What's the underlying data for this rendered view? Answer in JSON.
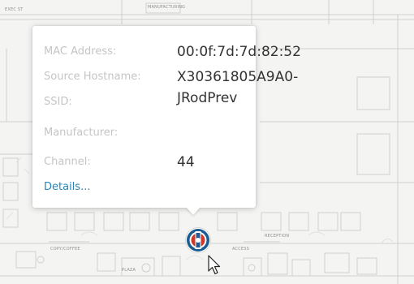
{
  "popup": {
    "rows": [
      {
        "label": "MAC Address:",
        "value": "00:0f:7d:7d:82:52"
      },
      {
        "label": "Source Hostname:",
        "value": "X30361805A9A0-"
      },
      {
        "label": "SSID:",
        "value": "JRodPrev"
      },
      {
        "label": "Manufacturer:",
        "value": ""
      },
      {
        "label": "Channel:",
        "value": "44"
      }
    ],
    "details_link": "Details..."
  },
  "floorplan": {
    "labels": [
      "EXEC ST",
      "MANUFACTURING",
      "COPY/COFFEE",
      "PLAZA",
      "RECEPTION",
      "ACCESS"
    ]
  },
  "colors": {
    "link": "#2a86b8",
    "label": "#c5c5c5",
    "value": "#333333",
    "ap_icon_blue": "#1d5c93",
    "ap_icon_red": "#d0382b"
  },
  "icons": {
    "access_point": "access-point-icon",
    "cursor": "mouse-pointer-icon"
  }
}
